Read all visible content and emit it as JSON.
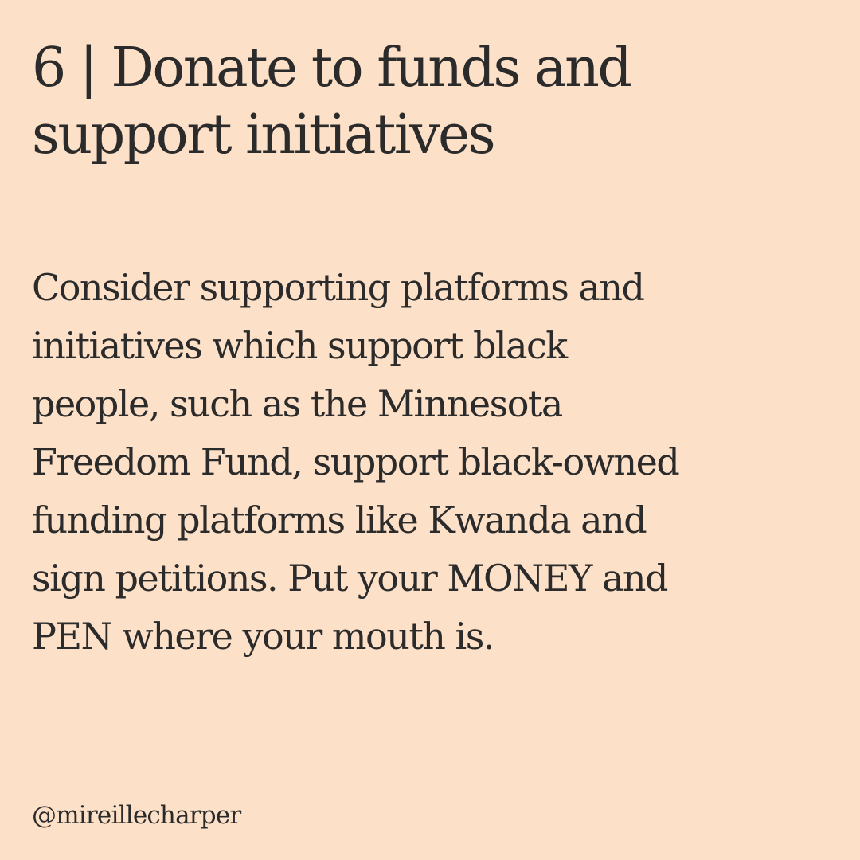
{
  "heading": {
    "lines": [
      "6 | Donate to funds and",
      "support initiatives"
    ]
  },
  "body": {
    "lines": [
      "Consider supporting platforms and",
      "initiatives which support black",
      "people, such as the Minnesota",
      "Freedom Fund, support black-owned",
      "funding platforms like Kwanda and",
      "sign petitions. Put your MONEY and",
      "PEN where your mouth is."
    ]
  },
  "footer": {
    "handle": "@mireillecharper"
  },
  "colors": {
    "background": "#fde0c8",
    "text": "#2b2b2b",
    "divider": "#3a3a3a"
  }
}
